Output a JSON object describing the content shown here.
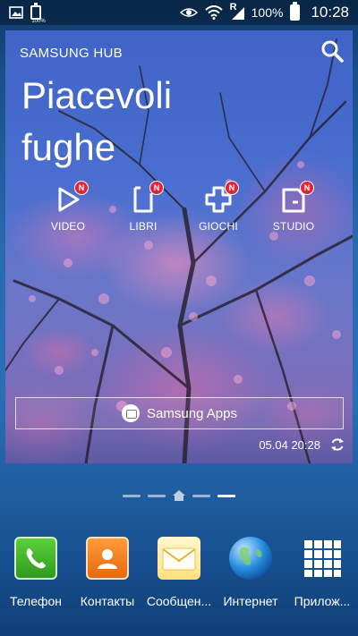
{
  "status_bar": {
    "left_icons": [
      "gallery-icon",
      "battery-full-icon"
    ],
    "mini_battery_label": "100%",
    "right_icons": [
      "eye-smart-stay-icon",
      "wifi-icon",
      "signal-roaming-icon",
      "battery-icon"
    ],
    "roaming_letter": "R",
    "battery_percent": "100%",
    "time": "10:28"
  },
  "hub": {
    "title": "SAMSUNG HUB",
    "headline_line1": "Piacevoli",
    "headline_line2": "fughe",
    "badge_letter": "N",
    "categories": [
      {
        "label": "VIDEO",
        "icon": "video-play-icon"
      },
      {
        "label": "LIBRI",
        "icon": "book-icon"
      },
      {
        "label": "GIOCHI",
        "icon": "gamepad-cross-icon"
      },
      {
        "label": "STUDIO",
        "icon": "graduation-icon"
      }
    ],
    "apps_button": "Samsung Apps",
    "updated": "05.04 20:28"
  },
  "pager": {
    "pages": 5,
    "home_index": 2,
    "active_index": 4
  },
  "dock": [
    {
      "label": "Телефон",
      "icon": "phone-icon"
    },
    {
      "label": "Контакты",
      "icon": "contacts-icon"
    },
    {
      "label": "Сообщен...",
      "icon": "message-envelope-icon"
    },
    {
      "label": "Интернет",
      "icon": "globe-icon"
    },
    {
      "label": "Прилож...",
      "icon": "apps-grid-icon"
    }
  ],
  "colors": {
    "badge": "#e0243a",
    "phone": "#3fb52a",
    "contacts": "#f07d1f",
    "wallpaper": "#2a6bb0"
  }
}
